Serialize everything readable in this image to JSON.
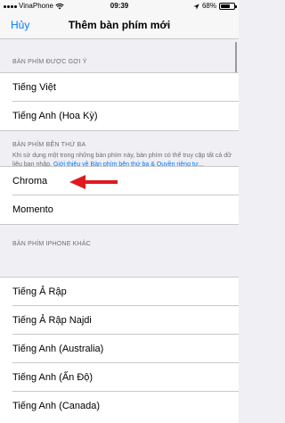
{
  "status_bar": {
    "carrier": "VinaPhone",
    "time": "09:39",
    "battery_percent": "68%",
    "battery_level": 0.68
  },
  "nav": {
    "cancel_label": "Hủy",
    "title": "Thêm bàn phím mới"
  },
  "suggested": {
    "header": "BÀN PHÍM ĐƯỢC GỢI Ý",
    "items": [
      {
        "label": "Tiếng Việt"
      },
      {
        "label": "Tiếng Anh (Hoa Kỳ)"
      }
    ]
  },
  "third_party": {
    "header": "BÀN PHÍM BÊN THỨ BA",
    "description": "Khi sử dụng một trong những bàn phím này, bàn phím có thể truy cập tất cả dữ liệu bạn nhập. ",
    "link_text": "Giới thiệu về Bàn phím bên thứ ba & Quyền riêng tư...",
    "items": [
      {
        "label": "Chroma"
      },
      {
        "label": "Momento"
      }
    ]
  },
  "other": {
    "header": "BÀN PHÍM IPHONE KHÁC",
    "items": [
      {
        "label": "Tiếng Ả Rập"
      },
      {
        "label": "Tiếng Ả Rập Najdi"
      },
      {
        "label": "Tiếng Anh (Australia)"
      },
      {
        "label": "Tiếng Anh (Ấn Độ)"
      },
      {
        "label": "Tiếng Anh (Canada)"
      }
    ]
  },
  "colors": {
    "accent": "#007aff",
    "arrow": "#e0191e",
    "background": "#efeff4",
    "secondary_text": "#6d6d72"
  }
}
